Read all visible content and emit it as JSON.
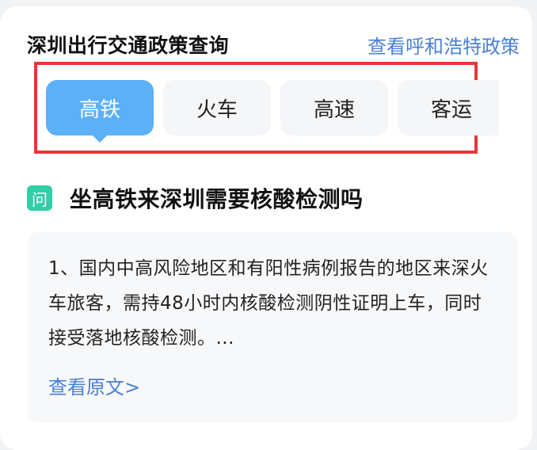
{
  "header": {
    "title": "深圳出行交通政策查询",
    "link": "查看呼和浩特政策"
  },
  "tabs": [
    {
      "label": "高铁",
      "active": true
    },
    {
      "label": "火车",
      "active": false
    },
    {
      "label": "高速",
      "active": false
    },
    {
      "label": "客运",
      "active": false
    }
  ],
  "question": {
    "icon_label": "问",
    "text": "坐高铁来深圳需要核酸检测吗"
  },
  "answer": {
    "text": "1、国内中高风险地区和有阳性病例报告的地区来深火车旅客，需持48小时内核酸检测阴性证明上车，同时接受落地核酸检测。...",
    "link": "查看原文>"
  },
  "colors": {
    "accent_blue": "#5bb0f8",
    "link_blue": "#4a7fd6",
    "highlight_red": "#e8363b",
    "question_icon_green": "#2fcfa8"
  }
}
